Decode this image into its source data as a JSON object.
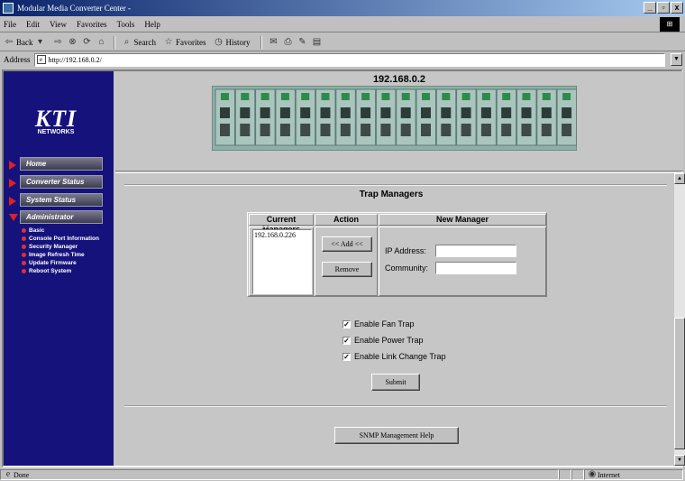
{
  "window": {
    "title": "Modular Media Converter Center -",
    "controls": [
      "_",
      "▫",
      "x"
    ]
  },
  "menubar": {
    "items": [
      "File",
      "Edit",
      "View",
      "Favorites",
      "Tools",
      "Help"
    ]
  },
  "toolbar": {
    "back": "Back",
    "search": "Search",
    "favorites": "Favorites",
    "history": "History"
  },
  "address": {
    "label": "Address",
    "url": "http://192.168.0.2/"
  },
  "sidebar": {
    "logo": "KTI",
    "logo_sub": "NETWORKS",
    "nav": [
      {
        "label": "Home",
        "icon": "arrow-right-icon"
      },
      {
        "label": "Converter Status",
        "icon": "arrow-right-icon"
      },
      {
        "label": "System Status",
        "icon": "arrow-right-icon"
      },
      {
        "label": "Administrator",
        "icon": "arrow-down-icon"
      }
    ],
    "sub_items": [
      "Basic",
      "Console Port Information",
      "Security Manager",
      "Image Refresh Time",
      "Update Firmware",
      "Reboot System"
    ]
  },
  "topframe": {
    "ip": "192.168.0.2",
    "slots": 18
  },
  "trap": {
    "title": "Trap Managers",
    "col_current": "Current Managers",
    "col_action": "Action",
    "col_new": "New Manager",
    "managers": [
      "192.168.0.226"
    ],
    "add_label": "<< Add <<",
    "remove_label": "Remove",
    "ip_label": "IP Address:",
    "ip_value": "",
    "community_label": "Community:",
    "community_value": ""
  },
  "options": [
    {
      "label": "Enable Fan Trap",
      "checked": true
    },
    {
      "label": "Enable Power Trap",
      "checked": true
    },
    {
      "label": "Enable Link Change Trap",
      "checked": true
    }
  ],
  "submit_label": "Submit",
  "help_label": "SNMP Management Help",
  "status": {
    "left": "Done",
    "zone": "Internet"
  },
  "colors": {
    "sidebar_bg": "#15127c",
    "nav_arrow": "#e02020",
    "page_bg": "#c6c6c6"
  }
}
